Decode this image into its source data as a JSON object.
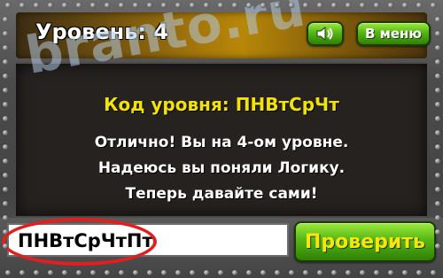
{
  "header": {
    "level_title": "Уровень: 4",
    "menu_label": "В меню",
    "sound_icon": "speaker-icon"
  },
  "panel": {
    "code_line": "Код уровня: ПНВтСрЧт",
    "messages": [
      "Отлично! Вы на 4-ом уровне.",
      "Надеюсь вы поняли Логику.",
      "Теперь давайте сами!"
    ]
  },
  "answer": {
    "value": "ПНВтСрЧтПт",
    "check_label": "Проверить"
  },
  "watermark": "branto.ru",
  "colors": {
    "code_yellow": "#f2e20a",
    "button_green": "#55b714",
    "highlight_red": "#e21f1f"
  }
}
